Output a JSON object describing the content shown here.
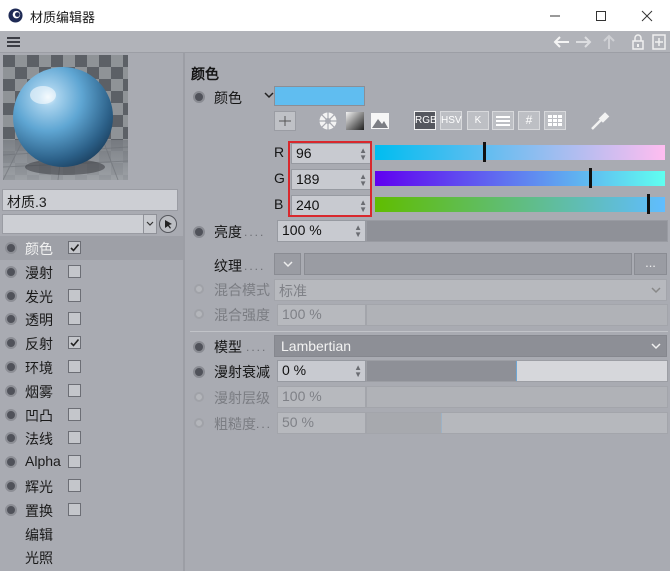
{
  "window": {
    "title": "材质编辑器",
    "controls": [
      "minimize-icon",
      "maximize-icon",
      "close-icon"
    ]
  },
  "toolbar": {
    "icons": [
      "menu-icon",
      "back-arrow-icon",
      "forward-arrow-icon",
      "up-arrow-icon",
      "lock-icon",
      "new-window-icon"
    ]
  },
  "material": {
    "name": "材质.3"
  },
  "channels": [
    {
      "label": "颜色",
      "checkable": true,
      "checked": true,
      "selected": true
    },
    {
      "label": "漫射",
      "checkable": true,
      "checked": false,
      "selected": false
    },
    {
      "label": "发光",
      "checkable": true,
      "checked": false,
      "selected": false
    },
    {
      "label": "透明",
      "checkable": true,
      "checked": false,
      "selected": false
    },
    {
      "label": "反射",
      "checkable": true,
      "checked": true,
      "selected": false
    },
    {
      "label": "环境",
      "checkable": true,
      "checked": false,
      "selected": false
    },
    {
      "label": "烟雾",
      "checkable": true,
      "checked": false,
      "selected": false
    },
    {
      "label": "凹凸",
      "checkable": true,
      "checked": false,
      "selected": false
    },
    {
      "label": "法线",
      "checkable": true,
      "checked": false,
      "selected": false
    },
    {
      "label": "Alpha",
      "checkable": true,
      "checked": false,
      "selected": false
    },
    {
      "label": "辉光",
      "checkable": true,
      "checked": false,
      "selected": false
    },
    {
      "label": "置换",
      "checkable": true,
      "checked": false,
      "selected": false
    },
    {
      "label": "编辑",
      "checkable": false,
      "checked": false,
      "selected": false
    },
    {
      "label": "光照",
      "checkable": false,
      "checked": false,
      "selected": false
    }
  ],
  "color_section": {
    "heading": "颜色",
    "color_label": "颜色",
    "swatch_color": "#60bdf0",
    "mode_buttons": {
      "rgb": "RGB",
      "hsv": "HSV",
      "k": "K",
      "mix": "",
      "hex": "#",
      "grid": ""
    },
    "r": {
      "label": "R",
      "value": "96",
      "fraction": 0.376
    },
    "g": {
      "label": "G",
      "value": "189",
      "fraction": 0.741
    },
    "b": {
      "label": "B",
      "value": "240",
      "fraction": 0.941
    },
    "highlight_color": "#d9282d"
  },
  "brightness": {
    "label": "亮度",
    "value": "100 %"
  },
  "texture": {
    "label": "纹理",
    "more_button": "..."
  },
  "blend_mode": {
    "label": "混合模式",
    "value": "标准"
  },
  "blend_strength": {
    "label": "混合强度",
    "value": "100 %"
  },
  "model": {
    "label": "模型",
    "value": "Lambertian"
  },
  "diffuse_falloff": {
    "label": "漫射衰减",
    "value": "0 %",
    "fraction": 0.5
  },
  "diffuse_level": {
    "label": "漫射层级",
    "value": "100 %"
  },
  "roughness": {
    "label": "粗糙度",
    "value": "50 %",
    "fraction": 0.25
  }
}
